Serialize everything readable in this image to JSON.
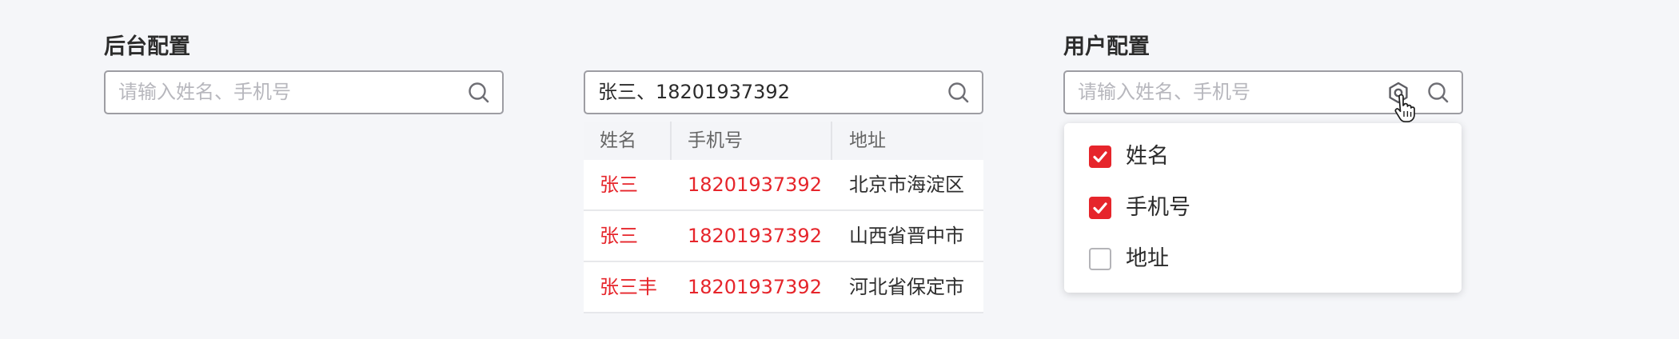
{
  "backend": {
    "title": "后台配置",
    "search_placeholder": "请输入姓名、手机号"
  },
  "middle": {
    "search_value": "张三、18201937392",
    "table": {
      "headers": [
        "姓名",
        "手机号",
        "地址"
      ],
      "rows": [
        [
          "张三",
          "18201937392",
          "北京市海淀区"
        ],
        [
          "张三",
          "18201937392",
          "山西省晋中市"
        ],
        [
          "张三丰",
          "18201937392",
          "河北省保定市"
        ]
      ]
    }
  },
  "user": {
    "title": "用户配置",
    "search_placeholder": "请输入姓名、手机号",
    "options": [
      {
        "label": "姓名",
        "checked": true
      },
      {
        "label": "手机号",
        "checked": true
      },
      {
        "label": "地址",
        "checked": false
      }
    ]
  },
  "icons": {
    "search": "search-icon",
    "settings": "settings-hex-icon",
    "cursor": "hand-pointer-icon",
    "check": "check-icon"
  },
  "colors": {
    "accent": "#e6252b",
    "border": "#9d9da3",
    "placeholder": "#b7b7bd",
    "background": "#f5f6f9"
  }
}
